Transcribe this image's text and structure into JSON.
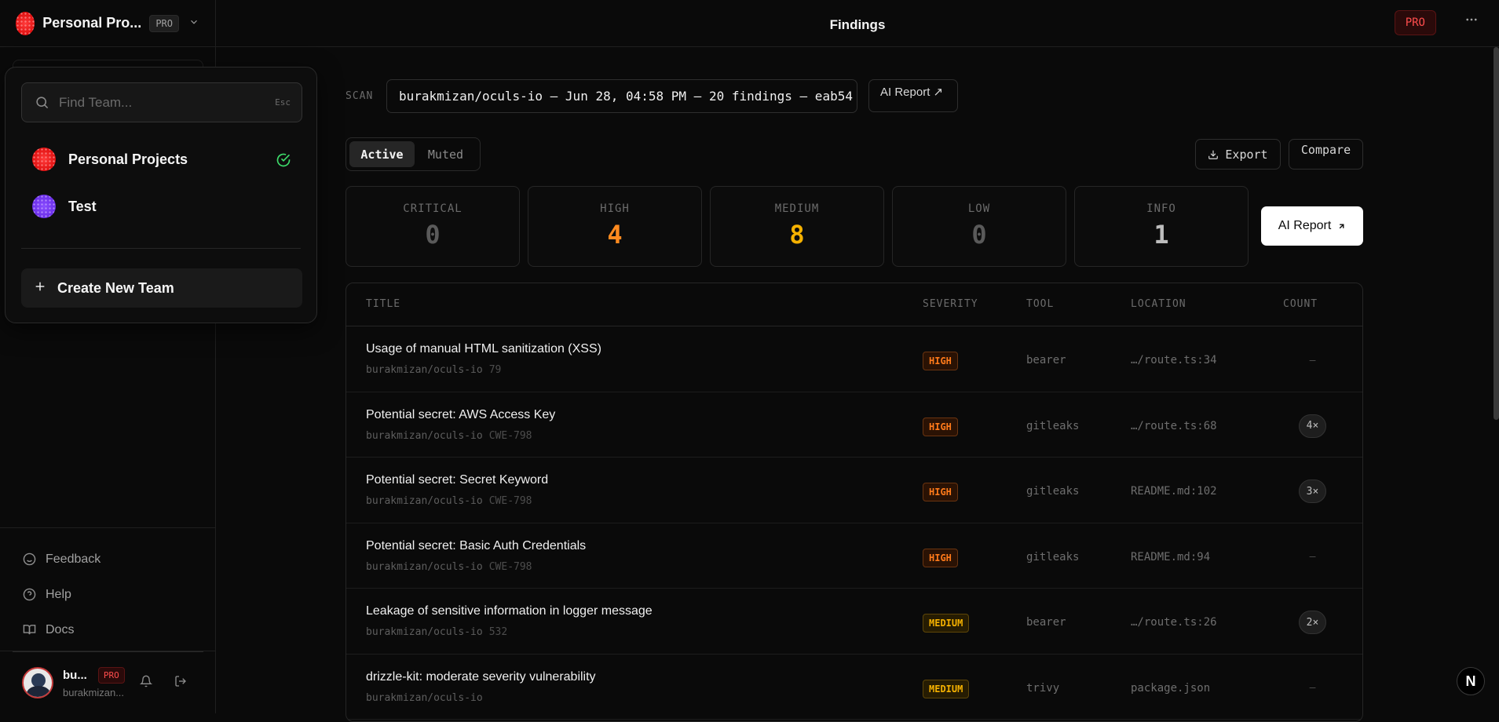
{
  "sidebar": {
    "team_name": "Personal Pro...",
    "team_badge": "PRO",
    "links": [
      {
        "label": "Feedback",
        "icon": "smile-icon"
      },
      {
        "label": "Help",
        "icon": "help-circle-icon"
      },
      {
        "label": "Docs",
        "icon": "book-icon"
      }
    ],
    "user": {
      "name": "bu...",
      "sub": "burakmizan...",
      "badge": "PRO"
    }
  },
  "topbar": {
    "title": "Findings",
    "pro_badge": "PRO"
  },
  "dropdown": {
    "search_placeholder": "Find Team...",
    "esc_hint": "Esc",
    "teams": [
      {
        "name": "Personal Projects",
        "selected": true,
        "color": "#e01010"
      },
      {
        "name": "Test",
        "selected": false,
        "color": "#6a2ee8"
      }
    ],
    "create_label": "Create New Team"
  },
  "scan": {
    "label": "SCAN",
    "value": "burakmizan/oculs-io — Jun 28, 04:58 PM — 20 findings — eab54",
    "ai_report": "AI Report ↗"
  },
  "tabs": {
    "active": "Active",
    "muted": "Muted"
  },
  "actions": {
    "export": "Export",
    "compare": "Compare",
    "ai_report": "AI Report"
  },
  "stats": [
    {
      "label": "CRITICAL",
      "value": "0",
      "color": "#5a5a5a"
    },
    {
      "label": "HIGH",
      "value": "4",
      "color": "#ff8a1f"
    },
    {
      "label": "MEDIUM",
      "value": "8",
      "color": "#f5b100"
    },
    {
      "label": "LOW",
      "value": "0",
      "color": "#5a5a5a"
    },
    {
      "label": "INFO",
      "value": "1",
      "color": "#bdbdbd"
    }
  ],
  "table": {
    "headers": {
      "title": "TITLE",
      "severity": "SEVERITY",
      "tool": "TOOL",
      "location": "LOCATION",
      "count": "COUNT"
    },
    "rows": [
      {
        "title": "Usage of manual HTML sanitization (XSS)",
        "repo": "burakmizan/oculs-io",
        "extra": "79",
        "severity": "HIGH",
        "tool": "bearer",
        "location": "…/route.ts:34",
        "count": "—"
      },
      {
        "title": "Potential secret: AWS Access Key",
        "repo": "burakmizan/oculs-io",
        "extra": "CWE-798",
        "severity": "HIGH",
        "tool": "gitleaks",
        "location": "…/route.ts:68",
        "count": "4×"
      },
      {
        "title": "Potential secret: Secret Keyword",
        "repo": "burakmizan/oculs-io",
        "extra": "CWE-798",
        "severity": "HIGH",
        "tool": "gitleaks",
        "location": "README.md:102",
        "count": "3×"
      },
      {
        "title": "Potential secret: Basic Auth Credentials",
        "repo": "burakmizan/oculs-io",
        "extra": "CWE-798",
        "severity": "HIGH",
        "tool": "gitleaks",
        "location": "README.md:94",
        "count": "—"
      },
      {
        "title": "Leakage of sensitive information in logger message",
        "repo": "burakmizan/oculs-io",
        "extra": "532",
        "severity": "MEDIUM",
        "tool": "bearer",
        "location": "…/route.ts:26",
        "count": "2×"
      },
      {
        "title": "drizzle-kit: moderate severity vulnerability",
        "repo": "burakmizan/oculs-io",
        "extra": "",
        "severity": "MEDIUM",
        "tool": "trivy",
        "location": "package.json",
        "count": "—"
      }
    ]
  },
  "next_badge": "N"
}
